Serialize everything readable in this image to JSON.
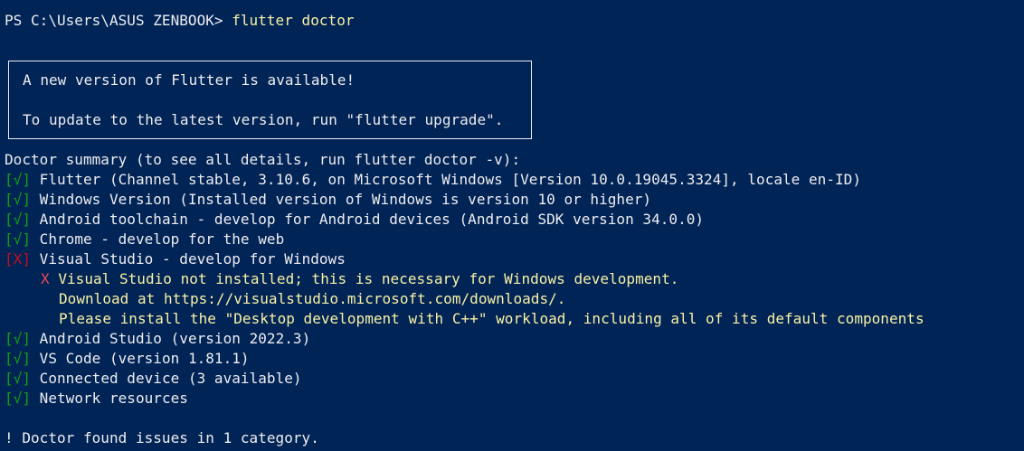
{
  "terminal": {
    "prompt": "PS C:\\Users\\ASUS ZENBOOK> ",
    "command": "flutter doctor"
  },
  "update_box": {
    "line1": "A new version of Flutter is available!",
    "line2": "To update to the latest version, run \"flutter upgrade\"."
  },
  "summary": "Doctor summary (to see all details, run flutter doctor -v):",
  "checks": [
    {
      "open": "[",
      "mark": "√",
      "close": "]",
      "text": " Flutter (Channel stable, 3.10.6, on Microsoft Windows [Version 10.0.19045.3324], locale en-ID)"
    },
    {
      "open": "[",
      "mark": "√",
      "close": "]",
      "text": " Windows Version (Installed version of Windows is version 10 or higher)"
    },
    {
      "open": "[",
      "mark": "√",
      "close": "]",
      "text": " Android toolchain - develop for Android devices (Android SDK version 34.0.0)"
    },
    {
      "open": "[",
      "mark": "√",
      "close": "]",
      "text": " Chrome - develop for the web"
    },
    {
      "open": "[",
      "mark": "X",
      "close": "]",
      "text": " Visual Studio - develop for Windows"
    }
  ],
  "vs_details": {
    "x_mark": "X",
    "line1": " Visual Studio not installed; this is necessary for Windows development.",
    "line2": "Download at https://visualstudio.microsoft.com/downloads/.",
    "line3": "Please install the \"Desktop development with C++\" workload, including all of its default components"
  },
  "checks2": [
    {
      "open": "[",
      "mark": "√",
      "close": "]",
      "text": " Android Studio (version 2022.3)"
    },
    {
      "open": "[",
      "mark": "√",
      "close": "]",
      "text": " VS Code (version 1.81.1)"
    },
    {
      "open": "[",
      "mark": "√",
      "close": "]",
      "text": " Connected device (3 available)"
    },
    {
      "open": "[",
      "mark": "√",
      "close": "]",
      "text": " Network resources"
    }
  ],
  "footer": "! Doctor found issues in 1 category.",
  "colors": {
    "background": "#012456",
    "text": "#eeedf0",
    "command": "#f9f1a5",
    "ok": "#13a10e",
    "fail": "#c50f1f",
    "warning": "#f9f1a5"
  }
}
